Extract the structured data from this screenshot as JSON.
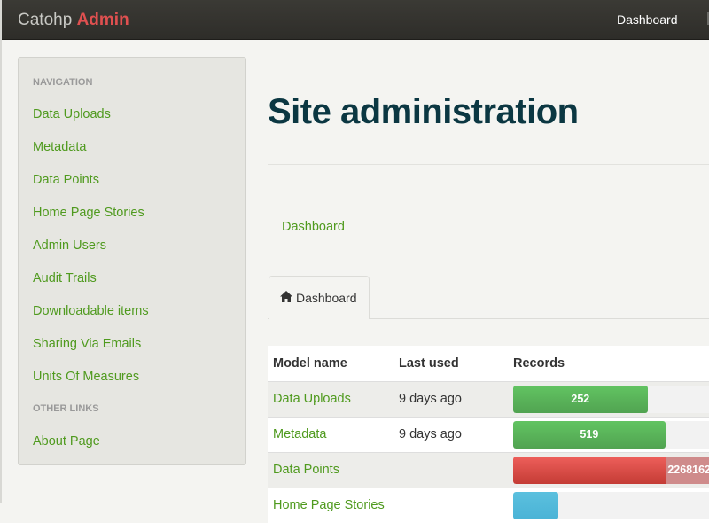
{
  "navbar": {
    "brand_main": "Catohp",
    "brand_accent": "Admin",
    "right_link": "Dashboard"
  },
  "sidebar": {
    "navigation_header": "NAVIGATION",
    "items": [
      {
        "label": "Data Uploads"
      },
      {
        "label": "Metadata"
      },
      {
        "label": "Data Points"
      },
      {
        "label": "Home Page Stories"
      },
      {
        "label": "Admin Users"
      },
      {
        "label": "Audit Trails"
      },
      {
        "label": "Downloadable items"
      },
      {
        "label": "Sharing Via Emails"
      },
      {
        "label": "Units Of Measures"
      }
    ],
    "other_header": "OTHER LINKS",
    "other_items": [
      {
        "label": "About Page"
      }
    ]
  },
  "main": {
    "title": "Site administration",
    "breadcrumb": "Dashboard",
    "tab": {
      "label": "Dashboard",
      "icon": "home-icon"
    },
    "table": {
      "headers": [
        "Model name",
        "Last used",
        "Records"
      ],
      "rows": [
        {
          "name": "Data Uploads",
          "last_used": "9 days ago",
          "records": "252",
          "fill": 0.68,
          "color": "green"
        },
        {
          "name": "Metadata",
          "last_used": "9 days ago",
          "records": "519",
          "fill": 0.77,
          "color": "green"
        },
        {
          "name": "Data Points",
          "last_used": "",
          "records": "2268162",
          "fill": 1.0,
          "color": "red"
        },
        {
          "name": "Home Page Stories",
          "last_used": "",
          "records": "",
          "fill": 0.23,
          "color": "blue"
        }
      ]
    }
  },
  "colors": {
    "link": "#4f9a1e",
    "brand_accent": "#e05050",
    "title": "#0b3742",
    "bar_green": "#5cb85c",
    "bar_red": "#d9534f",
    "bar_blue": "#5bc0de"
  }
}
